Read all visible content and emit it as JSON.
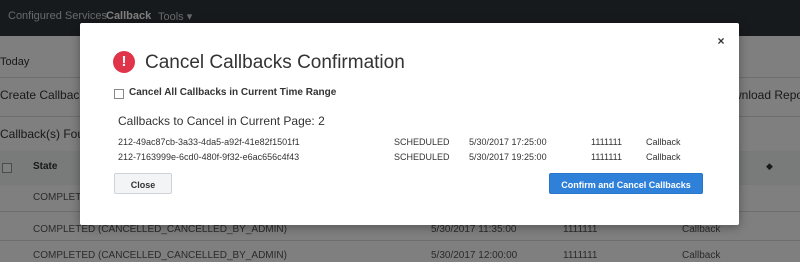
{
  "background": {
    "nav": {
      "items": [
        "Configured Services",
        "Callback",
        "Tools"
      ],
      "tools_chevron": "▾"
    },
    "left_labels": {
      "today": "Today",
      "create_callback": "Create Callback",
      "found": "Callback(s) Found"
    },
    "right_labels": {
      "download_report": "wnload Report"
    },
    "table": {
      "state_header": "State",
      "sort_icon": "sort-icon",
      "rows": [
        {
          "state": "COMPLETED",
          "time": "",
          "number": "",
          "type": ""
        },
        {
          "state": "COMPLETED (CANCELLED_CANCELLED_BY_ADMIN)",
          "time": "5/30/2017 11:35:00",
          "number": "1111111",
          "type": "Callback"
        },
        {
          "state": "COMPLETED (CANCELLED_CANCELLED_BY_ADMIN)",
          "time": "5/30/2017 12:00:00",
          "number": "1111111",
          "type": "Callback"
        }
      ]
    }
  },
  "modal": {
    "title": "Cancel Callbacks Confirmation",
    "title_icon": "alert-icon",
    "title_icon_glyph": "!",
    "close_glyph": "×",
    "checkbox_label": "Cancel All Callbacks in Current Time Range",
    "checkbox_checked": false,
    "subheading": "Callbacks to Cancel in Current Page: 2",
    "rows": [
      {
        "id": "212-49ac87cb-3a33-4da5-a92f-41e82f1501f1",
        "status": "SCHEDULED",
        "time": "5/30/2017 17:25:00",
        "number": "1111111",
        "type": "Callback"
      },
      {
        "id": "212-7163999e-6cd0-480f-9f32-e6ac656c4f43",
        "status": "SCHEDULED",
        "time": "5/30/2017 19:25:00",
        "number": "1111111",
        "type": "Callback"
      }
    ],
    "buttons": {
      "close": "Close",
      "confirm": "Confirm and Cancel Callbacks"
    }
  },
  "colors": {
    "accent": "#2e80d8",
    "alert": "#e0344a",
    "nav_bg": "#2f353b"
  }
}
